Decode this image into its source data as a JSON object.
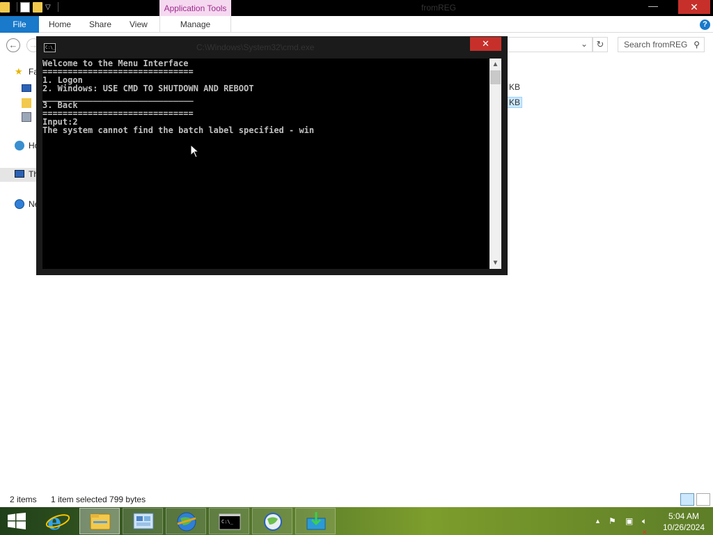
{
  "explorer": {
    "contextual_tab": "Application Tools",
    "window_title": "fromREG",
    "ribbon_tabs": [
      "File",
      "Home",
      "Share",
      "View",
      "Manage"
    ],
    "search_placeholder": "Search fromREG",
    "nav_pane": [
      {
        "label": "Fa",
        "icon": "star-favorites-icon"
      },
      {
        "label": "",
        "icon": "desktop-icon"
      },
      {
        "label": "",
        "icon": "downloads-icon"
      },
      {
        "label": "",
        "icon": "recent-places-icon"
      },
      {
        "label": "Ho",
        "icon": "homegroup-icon"
      },
      {
        "label": "Th",
        "icon": "this-pc-icon"
      },
      {
        "label": "Ne",
        "icon": "network-icon"
      }
    ],
    "file_sizes": [
      "KB",
      "KB"
    ],
    "status": {
      "item_count": "2 items",
      "selection": "1 item selected  799 bytes"
    }
  },
  "cmd": {
    "title": "C:\\Windows\\System32\\cmd.exe",
    "lines": [
      "Welcome to the Menu Interface",
      "==============================",
      "1. Logon",
      "2. Windows: USE CMD TO SHUTDOWN AND REBOOT",
      "______________________________",
      "3. Back",
      "==============================",
      "Input:2",
      "The system cannot find the batch label specified - win"
    ]
  },
  "taskbar": {
    "apps": [
      {
        "name": "internet-explorer",
        "icon": "ie-icon"
      },
      {
        "name": "file-explorer",
        "icon": "folder-icon",
        "active": true
      },
      {
        "name": "control-panel",
        "icon": "control-panel-icon"
      },
      {
        "name": "globe-app",
        "icon": "globe-icon"
      },
      {
        "name": "command-prompt",
        "icon": "cmd-icon"
      },
      {
        "name": "network-app",
        "icon": "network-globe-icon"
      },
      {
        "name": "download-app",
        "icon": "download-icon"
      }
    ],
    "clock_time": "5:04 AM",
    "clock_date": "10/26/2024"
  },
  "colors": {
    "file_tab": "#1979ca",
    "close_button": "#c7302a",
    "contextual_tab_bg": "#f5d9f0",
    "console_text": "#c0c0c0"
  }
}
